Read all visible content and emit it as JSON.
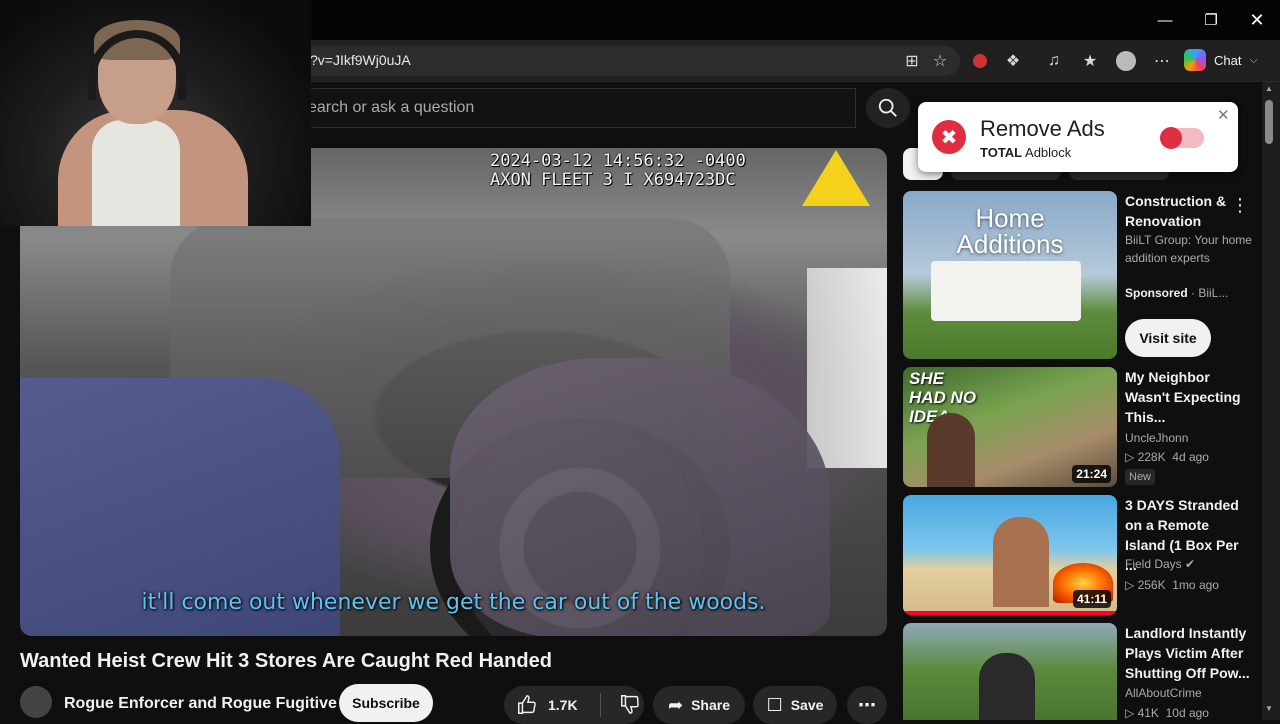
{
  "browser": {
    "url": "?v=JIkf9Wj0uJA",
    "chat_label": "Chat"
  },
  "youtube": {
    "search_placeholder": "earch or ask a question"
  },
  "video": {
    "timestamp": "2024-03-12 14:56:32 -0400\nAXON FLEET 3 I X694723DC",
    "caption": "it'll come out whenever we get the car out of the woods.",
    "title": "Wanted Heist Crew Hit 3 Stores Are Caught Red Handed",
    "channel": "Rogue Enforcer and Rogue Fugitive",
    "subscribe_label": "Subscribe",
    "likes": "1.7K",
    "share_label": "Share",
    "save_label": "Save"
  },
  "adblock": {
    "title": "Remove Ads",
    "brand": "TOTAL",
    "product": "Adblock"
  },
  "sidebar": {
    "ad": {
      "thumb_text": "Home\nAdditions",
      "title": "Construction & Renovation",
      "description": "BiiLT Group: Your home addition experts",
      "sponsored": "Sponsored",
      "advertiser": "BiiL...",
      "visit_label": "Visit site"
    },
    "videos": [
      {
        "title": "My Neighbor Wasn't Expecting This...",
        "channel": "UncleJhonn",
        "views": "228K",
        "age": "4d ago",
        "duration": "21:24",
        "badge": "New",
        "thumb_text": "SHE HAD NO IDEA."
      },
      {
        "title": "3 DAYS Stranded on a Remote Island (1 Box Per ...",
        "channel": "Field Days",
        "views": "256K",
        "age": "1mo ago",
        "duration": "41:11"
      },
      {
        "title": "Landlord Instantly Plays Victim After Shutting Off Pow...",
        "channel": "AllAboutCrime",
        "views": "41K",
        "age": "10d ago"
      }
    ]
  }
}
